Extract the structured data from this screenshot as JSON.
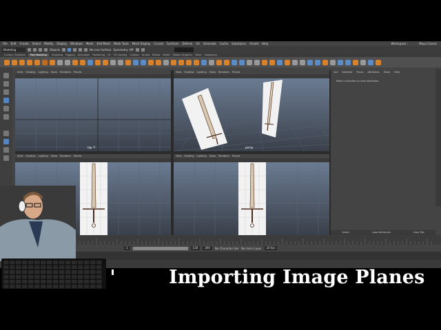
{
  "menubar": {
    "items": [
      "File",
      "Edit",
      "Create",
      "Select",
      "Modify",
      "Display",
      "Windows",
      "Mesh",
      "Edit Mesh",
      "Mesh Tools",
      "Mesh Display",
      "Curves",
      "Surfaces",
      "Deform",
      "UV",
      "Generate",
      "Cache",
      "Substance",
      "Arnold",
      "Help"
    ],
    "workspace_label": "Workspace :",
    "workspace_value": "Maya Classic"
  },
  "statusline": {
    "menu_set": "Modeling",
    "object_mode": "Objects",
    "live_surface": "No Live Surface",
    "symmetry": "Symmetry: Off"
  },
  "shelf": {
    "tabs": [
      "Curves / Surfaces",
      "Poly Modeling",
      "Sculpting",
      "Rigging",
      "Animation",
      "Rendering",
      "FX",
      "FX Caching",
      "Custom",
      "Arnold",
      "Bifrost",
      "MASH",
      "Motion Graphics",
      "XGen",
      "Substance"
    ],
    "active_tab": "Poly Modeling",
    "icon_colors": [
      "#d9822b",
      "#d9822b",
      "#d9822b",
      "#d9822b",
      "#d9822b",
      "#c06a1f",
      "#d9822b",
      "#999999",
      "#999999",
      "#d9822b",
      "#d9822b",
      "#5a8cc8",
      "#d9822b",
      "#d9822b",
      "#999999",
      "#999999",
      "#d9822b",
      "#5a8cc8",
      "#5a8cc8",
      "#d9822b",
      "#d9822b",
      "#999999",
      "#d9822b",
      "#d9822b",
      "#d9822b",
      "#d9822b",
      "#5a8cc8",
      "#999999",
      "#d9822b",
      "#d9822b",
      "#5a8cc8",
      "#5a8cc8",
      "#999999",
      "#999999",
      "#d9822b",
      "#d9822b",
      "#5a8cc8",
      "#d9822b",
      "#999999",
      "#999999",
      "#5a8cc8",
      "#5a8cc8",
      "#d9822b",
      "#999999",
      "#5a8cc8",
      "#5a8cc8",
      "#d9822b",
      "#999999",
      "#5a8cc8",
      "#d9822b"
    ]
  },
  "viewport_menu": [
    "View",
    "Shading",
    "Lighting",
    "Show",
    "Renderer",
    "Panels"
  ],
  "viewports": [
    {
      "name": "top-viewport",
      "label": "top -Y"
    },
    {
      "name": "persp-viewport",
      "label": "persp"
    },
    {
      "name": "side-viewport",
      "label": ""
    },
    {
      "name": "front-viewport",
      "label": ""
    }
  ],
  "attribute_editor": {
    "tabs": [
      "List",
      "Selected",
      "Focus",
      "Attributes",
      "Show",
      "Help"
    ],
    "message": "Make a selection to view attributes",
    "buttons": [
      "Select",
      "Load Attributes",
      "Copy Tab"
    ]
  },
  "range_slider": {
    "start": "1",
    "end": "120",
    "range_end": "120",
    "max_end": "200",
    "character_set": "No Character Set",
    "anim_layer": "No Anim Layer",
    "fps": "24 fps"
  },
  "caption": "Importing Image Planes"
}
